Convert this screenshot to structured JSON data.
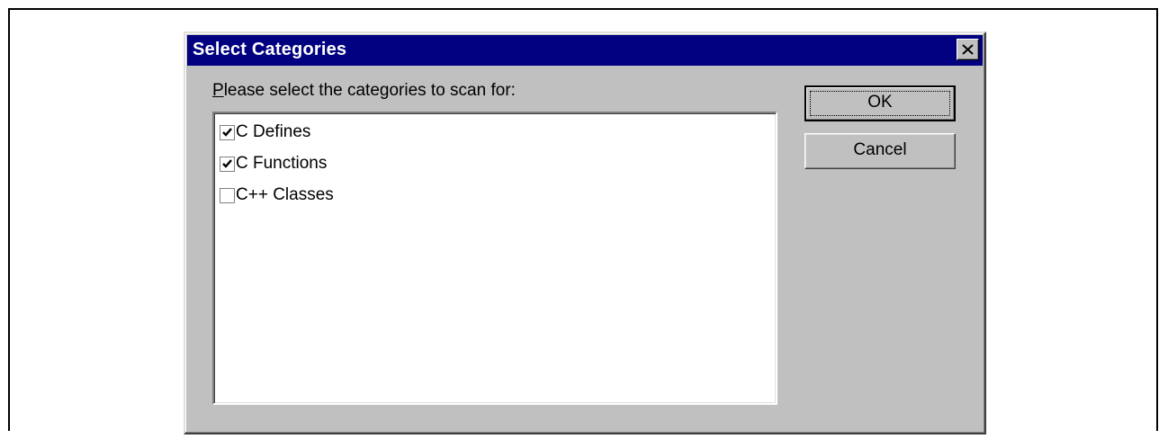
{
  "dialog": {
    "title": "Select Categories",
    "prompt_accel": "P",
    "prompt_rest": "lease select the categories to scan for:",
    "items": [
      {
        "label": "C Defines",
        "checked": true
      },
      {
        "label": "C Functions",
        "checked": true
      },
      {
        "label": "C++ Classes",
        "checked": false
      }
    ],
    "ok_label": "OK",
    "cancel_label": "Cancel"
  },
  "colors": {
    "titlebar": "#000080",
    "face": "#c0c0c0",
    "list_bg": "#ffffff"
  }
}
